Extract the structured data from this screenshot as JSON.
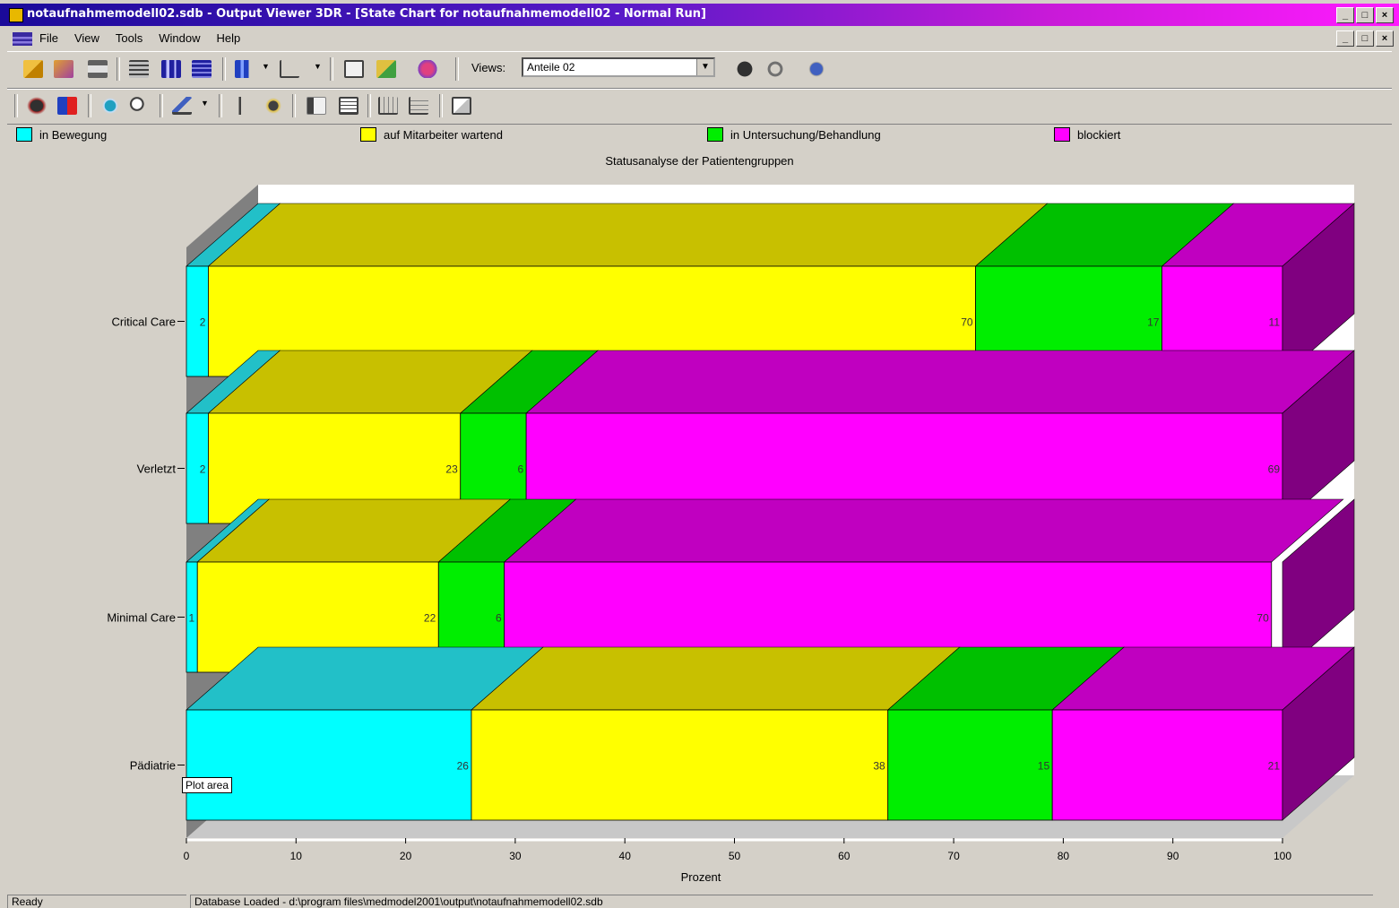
{
  "window": {
    "title": "notaufnahmemodell02.sdb - Output Viewer 3DR - [State Chart for notaufnahmemodell02 - Normal Run]",
    "min": "_",
    "max": "□",
    "close": "×"
  },
  "menu": {
    "items": [
      "File",
      "View",
      "Tools",
      "Window",
      "Help"
    ]
  },
  "toolbar": {
    "views_label": "Views:",
    "views_value": "Anteile 02"
  },
  "legend": {
    "items": [
      {
        "label": "in Bewegung",
        "color": "#00ffff"
      },
      {
        "label": "auf Mitarbeiter wartend",
        "color": "#ffff00"
      },
      {
        "label": "in Untersuchung/Behandlung",
        "color": "#00ee00"
      },
      {
        "label": "blockiert",
        "color": "#ff00ff"
      }
    ]
  },
  "tooltip": "Plot area",
  "status": {
    "ready": "Ready",
    "message": "Database Loaded - d:\\program files\\medmodel2001\\output\\notaufnahmemodell02.sdb"
  },
  "chart_data": {
    "type": "bar",
    "orientation": "horizontal",
    "stacked": true,
    "three_d": true,
    "title": "Statusanalyse der Patientengruppen",
    "xlabel": "Prozent",
    "ylabel": "",
    "xlim": [
      0,
      100
    ],
    "xticks": [
      0,
      10,
      20,
      30,
      40,
      50,
      60,
      70,
      80,
      90,
      100
    ],
    "categories": [
      "Critical Care",
      "Verletzt",
      "Minimal Care",
      "Pädiatrie"
    ],
    "series": [
      {
        "name": "in Bewegung",
        "color": "#00ffff",
        "top_color": "#22c0c8",
        "values": [
          2,
          2,
          1,
          26
        ]
      },
      {
        "name": "auf Mitarbeiter wartend",
        "color": "#ffff00",
        "top_color": "#c8c000",
        "values": [
          70,
          23,
          22,
          38
        ]
      },
      {
        "name": "in Untersuchung/Behandlung",
        "color": "#00ee00",
        "top_color": "#00c000",
        "values": [
          17,
          6,
          6,
          15
        ]
      },
      {
        "name": "blockiert",
        "color": "#ff00ff",
        "top_color": "#c000c0",
        "values": [
          11,
          69,
          70,
          21
        ]
      }
    ],
    "legend_position": "top",
    "grid": false
  }
}
